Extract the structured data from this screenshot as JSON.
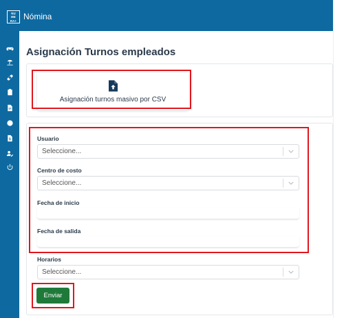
{
  "header": {
    "logo_text": "NU-ME-RA+",
    "app_title": "Nómina"
  },
  "sidebar": {
    "icons": [
      "gamepad-icon",
      "beach-icon",
      "pill-icon",
      "clipboard-icon",
      "document-icon",
      "moon-icon",
      "file-dollar-icon",
      "user-edit-icon",
      "power-icon"
    ]
  },
  "page": {
    "title": "Asignación Turnos empleados"
  },
  "bulk": {
    "label": "Asignación turnos masivo por CSV"
  },
  "form": {
    "usuario_label": "Usuario",
    "usuario_placeholder": "Seleccione...",
    "centro_label": "Centro de costo",
    "centro_placeholder": "Seleccione...",
    "fecha_inicio_label": "Fecha de inicio",
    "fecha_salida_label": "Fecha de salida",
    "horarios_label": "Horarios",
    "horarios_placeholder": "Seleccione...",
    "submit_label": "Enviar"
  },
  "colors": {
    "primary": "#0e69a0",
    "submit": "#1f7a3a",
    "highlight": "#e0161c"
  }
}
